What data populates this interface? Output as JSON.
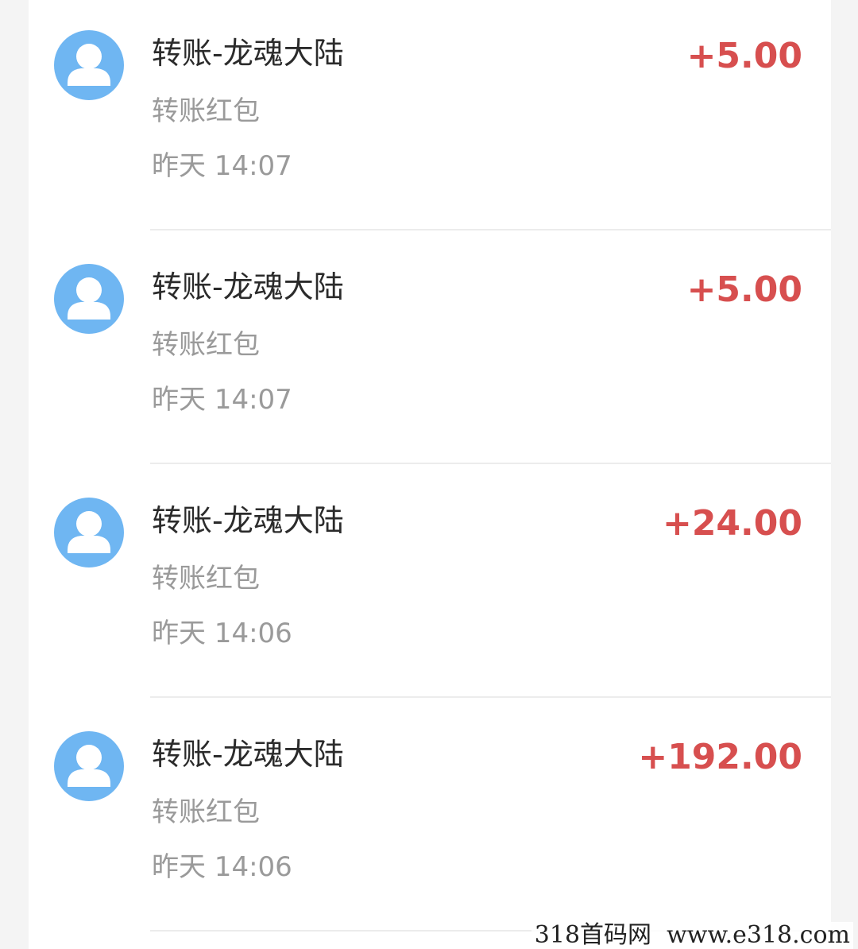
{
  "transactions": [
    {
      "title": "转账-龙魂大陆",
      "subtitle": "转账红包",
      "time": "昨天 14:07",
      "amount": "+5.00",
      "avatar_icon": "person-icon"
    },
    {
      "title": "转账-龙魂大陆",
      "subtitle": "转账红包",
      "time": "昨天 14:07",
      "amount": "+5.00",
      "avatar_icon": "person-icon"
    },
    {
      "title": "转账-龙魂大陆",
      "subtitle": "转账红包",
      "time": "昨天 14:06",
      "amount": "+24.00",
      "avatar_icon": "person-icon"
    },
    {
      "title": "转账-龙魂大陆",
      "subtitle": "转账红包",
      "time": "昨天 14:06",
      "amount": "+192.00",
      "avatar_icon": "person-icon"
    }
  ],
  "watermark": "318首码网  www.e318.com",
  "colors": {
    "amount": "#d74f4f",
    "avatar": "#6fb6f2",
    "title": "#2b2b2b",
    "secondary": "#9a9a9a"
  }
}
